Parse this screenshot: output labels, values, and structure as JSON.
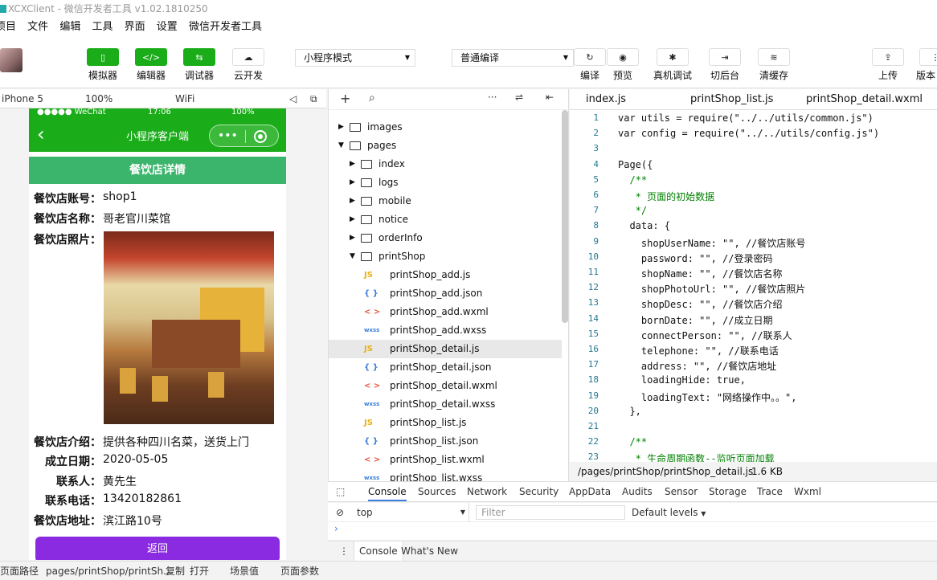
{
  "window": {
    "title": "XCXClient - 微信开发者工具 v1.02.1810250"
  },
  "menu": [
    "项目",
    "文件",
    "编辑",
    "工具",
    "界面",
    "设置",
    "微信开发者工具"
  ],
  "toolbar": {
    "simulator": "模拟器",
    "editor": "编辑器",
    "debugger": "调试器",
    "cloud": "云开发",
    "mode": "小程序模式",
    "compile_mode": "普通编译",
    "compile": "编译",
    "preview": "预览",
    "remote_debug": "真机调试",
    "background": "切后台",
    "clear_cache": "清缓存",
    "upload": "上传",
    "version": "版本"
  },
  "simbar": {
    "device": "iPhone 5",
    "zoom": "100%",
    "network": "WiFi"
  },
  "phone": {
    "status_left": "●●●●● WeChat",
    "status_time": "17:06",
    "status_battery": "100%",
    "nav_title": "小程序客户端",
    "page_header": "餐饮店详情",
    "fields": [
      {
        "key": "餐饮店账号：",
        "value": "shop1"
      },
      {
        "key": "餐饮店名称：",
        "value": "哥老官川菜馆"
      },
      {
        "key": "餐饮店照片：",
        "value": ""
      },
      {
        "key": "餐饮店介绍：",
        "value": "提供各种四川名菜，送货上门"
      },
      {
        "key": "成立日期：",
        "value": "2020-05-05"
      },
      {
        "key": "联系人：",
        "value": "黄先生"
      },
      {
        "key": "联系电话：",
        "value": "13420182861"
      },
      {
        "key": "餐饮店地址：",
        "value": "滨江路10号"
      }
    ],
    "back_button": "返回"
  },
  "explorer": {
    "items": [
      {
        "name": "images",
        "type": "folder",
        "level": 0,
        "open": false
      },
      {
        "name": "pages",
        "type": "folder",
        "level": 0,
        "open": true
      },
      {
        "name": "index",
        "type": "folder",
        "level": 1,
        "open": false
      },
      {
        "name": "logs",
        "type": "folder",
        "level": 1,
        "open": false
      },
      {
        "name": "mobile",
        "type": "folder",
        "level": 1,
        "open": false
      },
      {
        "name": "notice",
        "type": "folder",
        "level": 1,
        "open": false
      },
      {
        "name": "orderInfo",
        "type": "folder",
        "level": 1,
        "open": false
      },
      {
        "name": "printShop",
        "type": "folder",
        "level": 1,
        "open": true
      },
      {
        "name": "printShop_add.js",
        "type": "js",
        "level": 2
      },
      {
        "name": "printShop_add.json",
        "type": "json",
        "level": 2
      },
      {
        "name": "printShop_add.wxml",
        "type": "wxml",
        "level": 2
      },
      {
        "name": "printShop_add.wxss",
        "type": "wxss",
        "level": 2
      },
      {
        "name": "printShop_detail.js",
        "type": "js",
        "level": 2,
        "selected": true
      },
      {
        "name": "printShop_detail.json",
        "type": "json",
        "level": 2
      },
      {
        "name": "printShop_detail.wxml",
        "type": "wxml",
        "level": 2
      },
      {
        "name": "printShop_detail.wxss",
        "type": "wxss",
        "level": 2
      },
      {
        "name": "printShop_list.js",
        "type": "js",
        "level": 2
      },
      {
        "name": "printShop_list.json",
        "type": "json",
        "level": 2
      },
      {
        "name": "printShop_list.wxml",
        "type": "wxml",
        "level": 2
      },
      {
        "name": "printShop_list.wxss",
        "type": "wxss",
        "level": 2
      }
    ]
  },
  "editor_tabs": [
    "index.js",
    "printShop_list.js",
    "printShop_detail.wxml"
  ],
  "code": [
    {
      "n": "1",
      "t": "var utils = require(\"../../utils/common.js\")"
    },
    {
      "n": "2",
      "t": "var config = require(\"../../utils/config.js\")"
    },
    {
      "n": "3",
      "t": ""
    },
    {
      "n": "4",
      "t": "Page({"
    },
    {
      "n": "5",
      "t": "  /**"
    },
    {
      "n": "6",
      "t": "   * 页面的初始数据"
    },
    {
      "n": "7",
      "t": "   */"
    },
    {
      "n": "8",
      "t": "  data: {"
    },
    {
      "n": "9",
      "t": "    shopUserName: \"\", //餐饮店账号"
    },
    {
      "n": "10",
      "t": "    password: \"\", //登录密码"
    },
    {
      "n": "11",
      "t": "    shopName: \"\", //餐饮店名称"
    },
    {
      "n": "12",
      "t": "    shopPhotoUrl: \"\", //餐饮店照片"
    },
    {
      "n": "13",
      "t": "    shopDesc: \"\", //餐饮店介绍"
    },
    {
      "n": "14",
      "t": "    bornDate: \"\", //成立日期"
    },
    {
      "n": "15",
      "t": "    connectPerson: \"\", //联系人"
    },
    {
      "n": "16",
      "t": "    telephone: \"\", //联系电话"
    },
    {
      "n": "17",
      "t": "    address: \"\", //餐饮店地址"
    },
    {
      "n": "18",
      "t": "    loadingHide: true,"
    },
    {
      "n": "19",
      "t": "    loadingText: \"网络操作中。。\","
    },
    {
      "n": "20",
      "t": "  },"
    },
    {
      "n": "21",
      "t": ""
    },
    {
      "n": "22",
      "t": "  /**"
    },
    {
      "n": "23",
      "t": "   * 生命周期函数--监听页面加载"
    }
  ],
  "editor_status": {
    "path": "/pages/printShop/printShop_detail.js",
    "size": "1.6 KB"
  },
  "devtools_tabs": [
    "Console",
    "Sources",
    "Network",
    "Security",
    "AppData",
    "Audits",
    "Sensor",
    "Storage",
    "Trace",
    "Wxml"
  ],
  "console": {
    "context": "top",
    "filter_placeholder": "Filter",
    "levels": "Default levels"
  },
  "drawer": {
    "console": "Console",
    "whats_new": "What's New"
  },
  "footer": {
    "path_label": "页面路径",
    "path": "pages/printShop/printSh...",
    "copy": "复制",
    "open": "打开",
    "scene": "场景值",
    "params": "页面参数"
  },
  "colors": {
    "wechat_green": "#1aad19",
    "header_green": "#3bb56c",
    "button_purple": "#8a2be2"
  }
}
